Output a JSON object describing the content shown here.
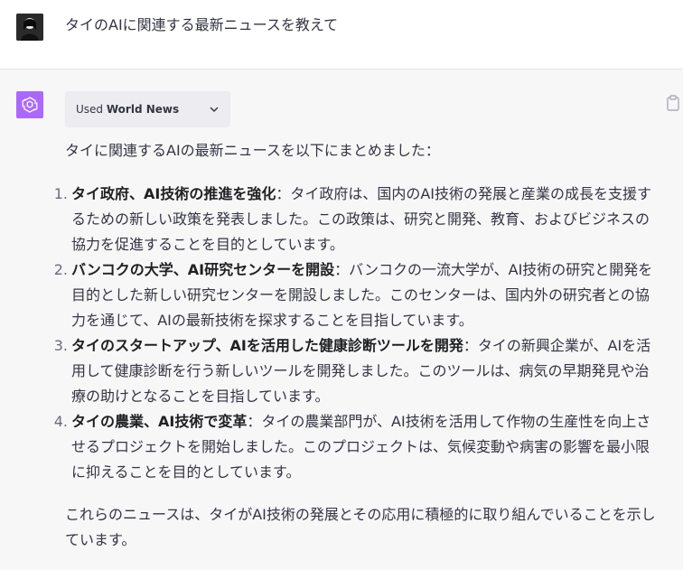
{
  "user_message": {
    "text": "タイのAIに関連する最新ニュースを教えて"
  },
  "assistant": {
    "plugin": {
      "used_label": "Used",
      "name": "World News"
    },
    "intro": "タイに関連するAIの最新ニュースを以下にまとめました：",
    "news": [
      {
        "number": "1.",
        "title": "タイ政府、AI技術の推進を強化",
        "body": "：タイ政府は、国内のAI技術の発展と産業の成長を支援するための新しい政策を発表しました。この政策は、研究と開発、教育、およびビジネスの協力を促進することを目的としています。"
      },
      {
        "number": "2.",
        "title": "バンコクの大学、AI研究センターを開設",
        "body": "：バンコクの一流大学が、AI技術の研究と開発を目的とした新しい研究センターを開設しました。このセンターは、国内外の研究者との協力を通じて、AIの最新技術を探求することを目指しています。"
      },
      {
        "number": "3.",
        "title": "タイのスタートアップ、AIを活用した健康診断ツールを開発",
        "body": "：タイの新興企業が、AIを活用して健康診断を行う新しいツールを開発しました。このツールは、病気の早期発見や治療の助けとなることを目指しています。"
      },
      {
        "number": "4.",
        "title": "タイの農業、AI技術で変革",
        "body": "：タイの農業部門が、AI技術を活用して作物の生産性を向上させるプロジェクトを開始しました。このプロジェクトは、気候変動や病害の影響を最小限に抑えることを目的としています。"
      }
    ],
    "summary": "これらのニュースは、タイがAI技術の発展とその応用に積極的に取り組んでいることを示しています。"
  },
  "colors": {
    "assistant_avatar": "#ab68ff",
    "assistant_bg": "#f7f7f8",
    "chip_bg": "#ececf1"
  }
}
